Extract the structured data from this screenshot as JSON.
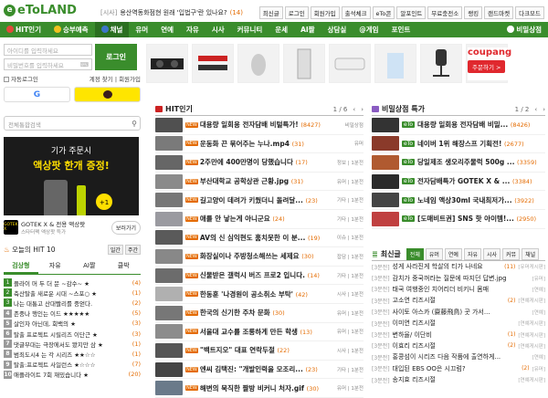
{
  "header": {
    "logo": "eToLAND",
    "notice_tag": "[시사]",
    "notice_text": "용산역동화점현 원래 '입법구'란 있나요?",
    "notice_count": "(14)",
    "links": [
      "최신글",
      "로그인",
      "회원가입",
      "출석체크",
      "eTo콘",
      "알포인트",
      "무료충전소",
      "랭킹",
      "랜드마켓",
      "다크모드"
    ]
  },
  "nav": [
    "HIT인기",
    "승부예측",
    "채널",
    "유머",
    "연예",
    "자유",
    "시사",
    "커뮤니티",
    "운세",
    "AI짤",
    "상담실",
    "@게임",
    "포인트",
    "비밀상점"
  ],
  "login": {
    "id_placeholder": "아이디를 입력하세요",
    "pw_placeholder": "비밀번호를 입력하세요",
    "button": "로그인",
    "auto_login": "자동로그인",
    "find": "계정 찾기 | 회원가입"
  },
  "products_ad": {
    "brand": "coupang",
    "button": "주문하기 >"
  },
  "search": {
    "placeholder": "전체통합검색"
  },
  "ad": {
    "line1": "기가 주문시",
    "line2": "액상팟 한개 증정!",
    "bonus": "+1",
    "logo_text": "GOTEK X",
    "title": "GOTEK X & 전용 액상팟",
    "subtitle": "스타터팩 액상팟 득가",
    "more": "보러가기"
  },
  "hit10": {
    "title": "오늘의 HIT 10",
    "switch": [
      "일간",
      "주간"
    ],
    "tabs": [
      "검상형",
      "자유",
      "AI짤",
      "클박"
    ],
    "items": [
      {
        "rank": "1",
        "title": "플라이 머 두 더 문 ~감수~ ★",
        "count": "(4)"
      },
      {
        "rank": "2",
        "title": "축산탈출 새로운 시대 ~스포○ ★",
        "count": "(1)"
      },
      {
        "rank": "3",
        "title": "나는 대통고 산대빨리를 중얻다.",
        "count": "(2)"
      },
      {
        "rank": "4",
        "title": "존중나 행인는 이드 ★★★★★",
        "count": "(5)"
      },
      {
        "rank": "5",
        "title": "살인자 아닌데, 회백의 ★",
        "count": "(3)"
      },
      {
        "rank": "6",
        "title": "탈출 프로젝트 시릴리즈 이단근 ★",
        "count": "(3)"
      },
      {
        "rank": "7",
        "title": "댓글부대는 극장에서도 봤지만 삼 ★",
        "count": "(1)"
      },
      {
        "rank": "8",
        "title": "범죄도시4 는 각 시리즈 ★★☆☆",
        "count": "(1)"
      },
      {
        "rank": "9",
        "title": "탈출:프로젝트 사일런스 ★☆☆☆",
        "count": "(7)"
      },
      {
        "rank": "10",
        "title": "애플라이트 7회 재밌습니다 ★",
        "count": "(20)"
      }
    ]
  },
  "hit_board": {
    "title": "HIT인기",
    "page": "1 / 6",
    "items": [
      {
        "title": "대용량 일회용 전자담배 비털특가!",
        "count": "(8427)",
        "cat": "비밀상점",
        "ad": true
      },
      {
        "title": "운동화 끈 묶어주는 누나.mp4",
        "count": "(31)",
        "cat": "유머",
        "ad": false
      },
      {
        "title": "2주만에 400만명이 당했습니다",
        "count": "(17)",
        "cat": "정보 | 1분전",
        "ad": false
      },
      {
        "title": "부산대학교 공학상관 근황.jpg",
        "count": "(31)",
        "cat": "유머 | 1분전",
        "ad": false
      },
      {
        "title": "길고양이 데려가 키웠더니 돌려달...",
        "count": "(23)",
        "cat": "기타 | 1분전",
        "ad": false
      },
      {
        "title": "애를 안 낳는게 아니군요",
        "count": "(24)",
        "cat": "기타 | 1분전",
        "ad": false
      },
      {
        "title": "AV의 신 심익현도 훔치못한 이 분...",
        "count": "(19)",
        "cat": "이슈 | 1분전",
        "ad": false
      },
      {
        "title": "화장실이나 주방청소해쓰는 세제요",
        "count": "(30)",
        "cat": "잡담 | 1분전",
        "ad": false
      },
      {
        "title": "신물받은 갤럭시 버즈 프로2 입니다.",
        "count": "(14)",
        "cat": "기타 | 1분전",
        "ad": false
      },
      {
        "title": "한동훈 '나경원이 공소취소 부탁'",
        "count": "(42)",
        "cat": "시사 | 1분전",
        "ad": false
      },
      {
        "title": "한국의 신기한 주차 문화",
        "count": "(30)",
        "cat": "유머 | 1분전",
        "ad": false
      },
      {
        "title": "서울대 교수를 조롱하게 만든 학생",
        "count": "(13)",
        "cat": "유머 | 1분전",
        "ad": false
      },
      {
        "title": "\"백트지오\" 대표 연락두절",
        "count": "(22)",
        "cat": "시사 | 1분전",
        "ad": false
      },
      {
        "title": "엔씨 김택진: \"개발인력을 모조리...",
        "count": "(23)",
        "cat": "기타 | 1분전",
        "ad": false
      },
      {
        "title": "해변의 묵직한 짤방 비커니 처자.gif",
        "count": "(30)",
        "cat": "유머 | 1분전",
        "ad": false
      }
    ]
  },
  "secret_board": {
    "title": "비밀상점 특가",
    "page": "1 / 2",
    "items": [
      {
        "title": "대용량 일회용 전자담배 비밀...",
        "count": "(8426)"
      },
      {
        "title": "네이버 1위 해장스프 기획전!",
        "count": "(2677)"
      },
      {
        "title": "당일제조 생오리주물럭 500g ...",
        "count": "(3359)"
      },
      {
        "title": "전자담배특가 GOTEK X & ...",
        "count": "(3384)"
      },
      {
        "title": "노네임 액상30ml 국내최저가...",
        "count": "(3922)"
      },
      {
        "title": "[도매비트권] SNS 핫 아이템!...",
        "count": "(2950)"
      }
    ]
  },
  "latest": {
    "title": "최신글",
    "tabs": [
      "전체",
      "유머",
      "연예",
      "자유",
      "시사",
      "커뮤",
      "채널"
    ],
    "items": [
      {
        "cat": "[3분전]",
        "title": "성게 사라진게 학살의 티가 나네요",
        "count": "(11)",
        "board": "[유머게시판]"
      },
      {
        "cat": "[3분전]",
        "title": "감치가 중국꺼라는 질문에 따지던 답변.jpg",
        "count": "",
        "board": "[유머]"
      },
      {
        "cat": "[3분전]",
        "title": "태국 여행중인 치어리더 비키니 몸매",
        "count": "",
        "board": "[연예]"
      },
      {
        "cat": "[3분전]",
        "title": "고소연 리즈시절",
        "count": "(2)",
        "board": "[연예게시판]"
      },
      {
        "cat": "[3분전]",
        "title": "사이토 아스카 (齋藤飛鳥) 곳 가서...",
        "count": "",
        "board": "[연예]"
      },
      {
        "cat": "[3분전]",
        "title": "이미연 리즈시절",
        "count": "",
        "board": "[연예게시판]"
      },
      {
        "cat": "[3분전]",
        "title": "변하율/ 이단비",
        "count": "(1)",
        "board": "[연예게시판]"
      },
      {
        "cat": "[3분전]",
        "title": "이효리 리즈시절",
        "count": "(2)",
        "board": "[연예게시판]"
      },
      {
        "cat": "[3분전]",
        "title": "홍콩섬이 시리즈 다음 작품에 출연하게...",
        "count": "",
        "board": "[연예]"
      },
      {
        "cat": "[3분전]",
        "title": "대입된 EBS OO은 시끄럼?",
        "count": "(2)",
        "board": "[유머]"
      },
      {
        "cat": "[3분전]",
        "title": "송지효 리즈시절",
        "count": "",
        "board": "[연예게시판]"
      }
    ]
  },
  "colors": {
    "brand": "#3a8d2c",
    "accent": "#e46b00",
    "coupang": "#e0282e"
  }
}
